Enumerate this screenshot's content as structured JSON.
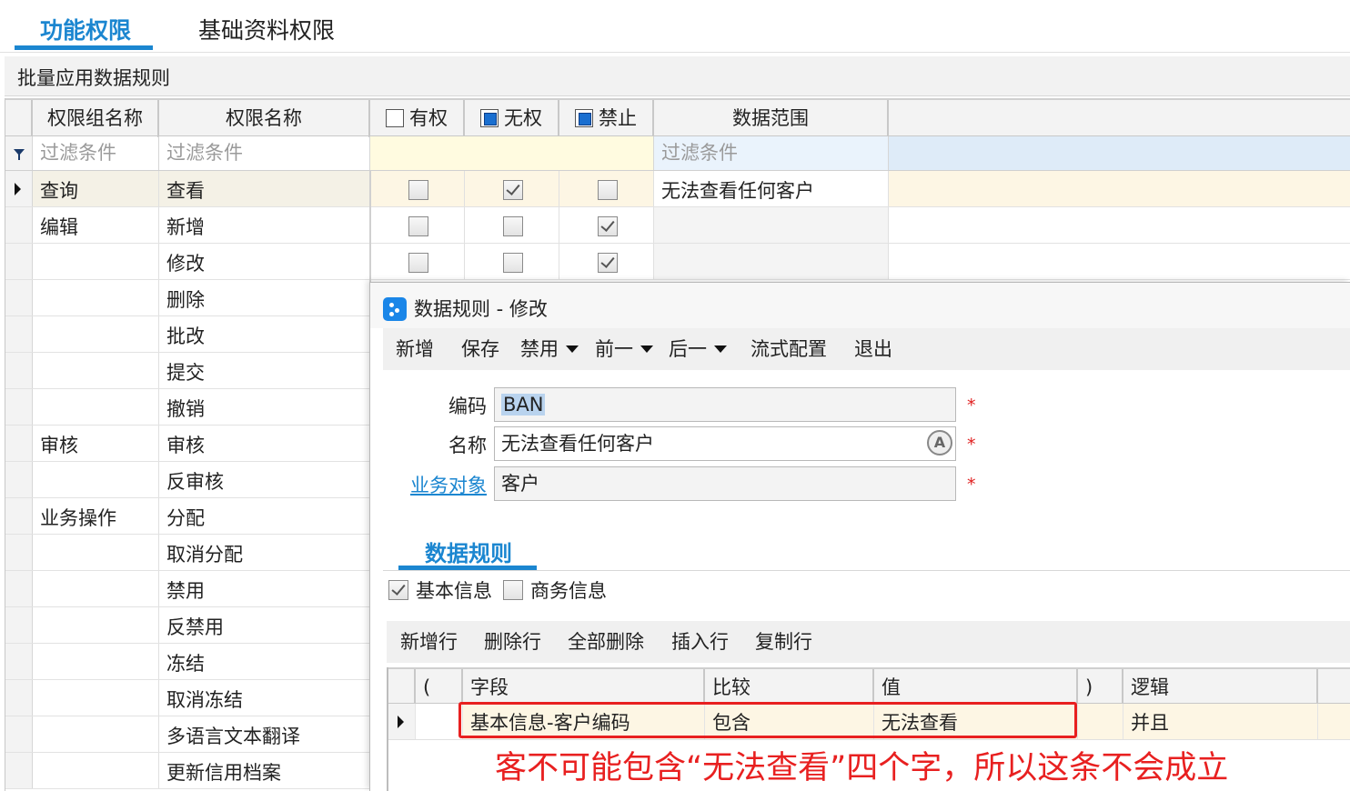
{
  "tabs": {
    "items": [
      "功能权限",
      "基础资料权限"
    ]
  },
  "batch_bar": {
    "label": "批量应用数据规则"
  },
  "grid": {
    "headers": {
      "group": "权限组名称",
      "name": "权限名称",
      "has": "有权",
      "none": "无权",
      "forbid": "禁止",
      "scope": "数据范围"
    },
    "filter_placeholder": "过滤条件",
    "rows": [
      {
        "group": "查询",
        "name": "查看",
        "has": false,
        "none": true,
        "forbid": false,
        "scope": "无法查看任何客户",
        "current": true
      },
      {
        "group": "编辑",
        "name": "新增",
        "has": false,
        "none": false,
        "forbid": true,
        "scope": ""
      },
      {
        "group": "",
        "name": "修改",
        "has": false,
        "none": false,
        "forbid": true,
        "scope": ""
      },
      {
        "group": "",
        "name": "删除"
      },
      {
        "group": "",
        "name": "批改"
      },
      {
        "group": "",
        "name": "提交"
      },
      {
        "group": "",
        "name": "撤销"
      },
      {
        "group": "审核",
        "name": "审核"
      },
      {
        "group": "",
        "name": "反审核"
      },
      {
        "group": "业务操作",
        "name": "分配"
      },
      {
        "group": "",
        "name": "取消分配"
      },
      {
        "group": "",
        "name": "禁用"
      },
      {
        "group": "",
        "name": "反禁用"
      },
      {
        "group": "",
        "name": "冻结"
      },
      {
        "group": "",
        "name": "取消冻结"
      },
      {
        "group": "",
        "name": "多语言文本翻译"
      },
      {
        "group": "",
        "name": "更新信用档案"
      }
    ]
  },
  "dialog": {
    "title": "数据规则 - 修改",
    "toolbar": {
      "new": "新增",
      "save": "保存",
      "disable": "禁用",
      "prev": "前一",
      "next": "后一",
      "flow": "流式配置",
      "exit": "退出"
    },
    "fields": {
      "code_label": "编码",
      "code_value": "BAN",
      "name_label": "名称",
      "name_value": "无法查看任何客户",
      "object_label": "业务对象",
      "object_value": "客户",
      "required": "*"
    },
    "subtab": "数据规则",
    "checks": [
      {
        "label": "基本信息",
        "checked": true
      },
      {
        "label": "商务信息",
        "checked": false
      }
    ],
    "entry_toolbar": {
      "add_row": "新增行",
      "delete_row": "删除行",
      "delete_all": "全部删除",
      "insert_row": "插入行",
      "copy_row": "复制行"
    },
    "entry_grid": {
      "headers": {
        "lparen": "(",
        "field": "字段",
        "compare": "比较",
        "value": "值",
        "rparen": ")",
        "logic": "逻辑"
      },
      "row": {
        "lparen": "",
        "field": "基本信息-客户编码",
        "compare": "包含",
        "value": "无法查看",
        "rparen": "",
        "logic": "并且"
      }
    },
    "annotation": "客不可能包含“无法查看”四个字，所以这条不会成立"
  },
  "colors": {
    "accent": "#1b86d0",
    "annotation_red": "#e82020",
    "current_row_bg": "#fdf6e4",
    "filter_bg": "#fffbe0"
  }
}
